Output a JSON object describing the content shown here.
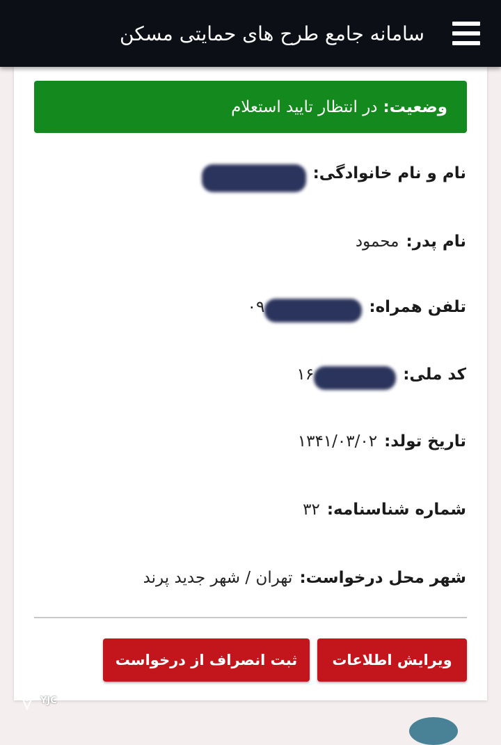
{
  "header": {
    "title": "سامانه جامع طرح های حمایتی مسکن"
  },
  "status": {
    "label": "وضعیت:",
    "value": "در انتظار تایید استعلام"
  },
  "fields": [
    {
      "label": "نام و نام خانوادگی:",
      "value": ""
    },
    {
      "label": "نام پدر:",
      "value": "محمود"
    },
    {
      "label": "تلفن همراه:",
      "value": "۰۹"
    },
    {
      "label": "کد ملی:",
      "value": "۱۶"
    },
    {
      "label": "تاریخ تولد:",
      "value": "۱۳۴۱/۰۳/۰۲"
    },
    {
      "label": "شماره شناسنامه:",
      "value": "۳۲"
    },
    {
      "label": "شهر محل درخواست:",
      "value": "تهران / شهر جدید پرند"
    }
  ],
  "actions": {
    "edit_label": "ویرایش اطلاعات",
    "cancel_label": "ثبت انصراف از درخواست"
  },
  "watermark": {
    "text": "YJC"
  },
  "colors": {
    "header_bg": "#0d0f16",
    "status_bg": "#14891e",
    "button_bg": "#c3161c",
    "redaction": "#1c2550"
  },
  "icons": {
    "menu": "hamburger-menu-icon",
    "watermark_logo": "yjc-logo-icon"
  }
}
